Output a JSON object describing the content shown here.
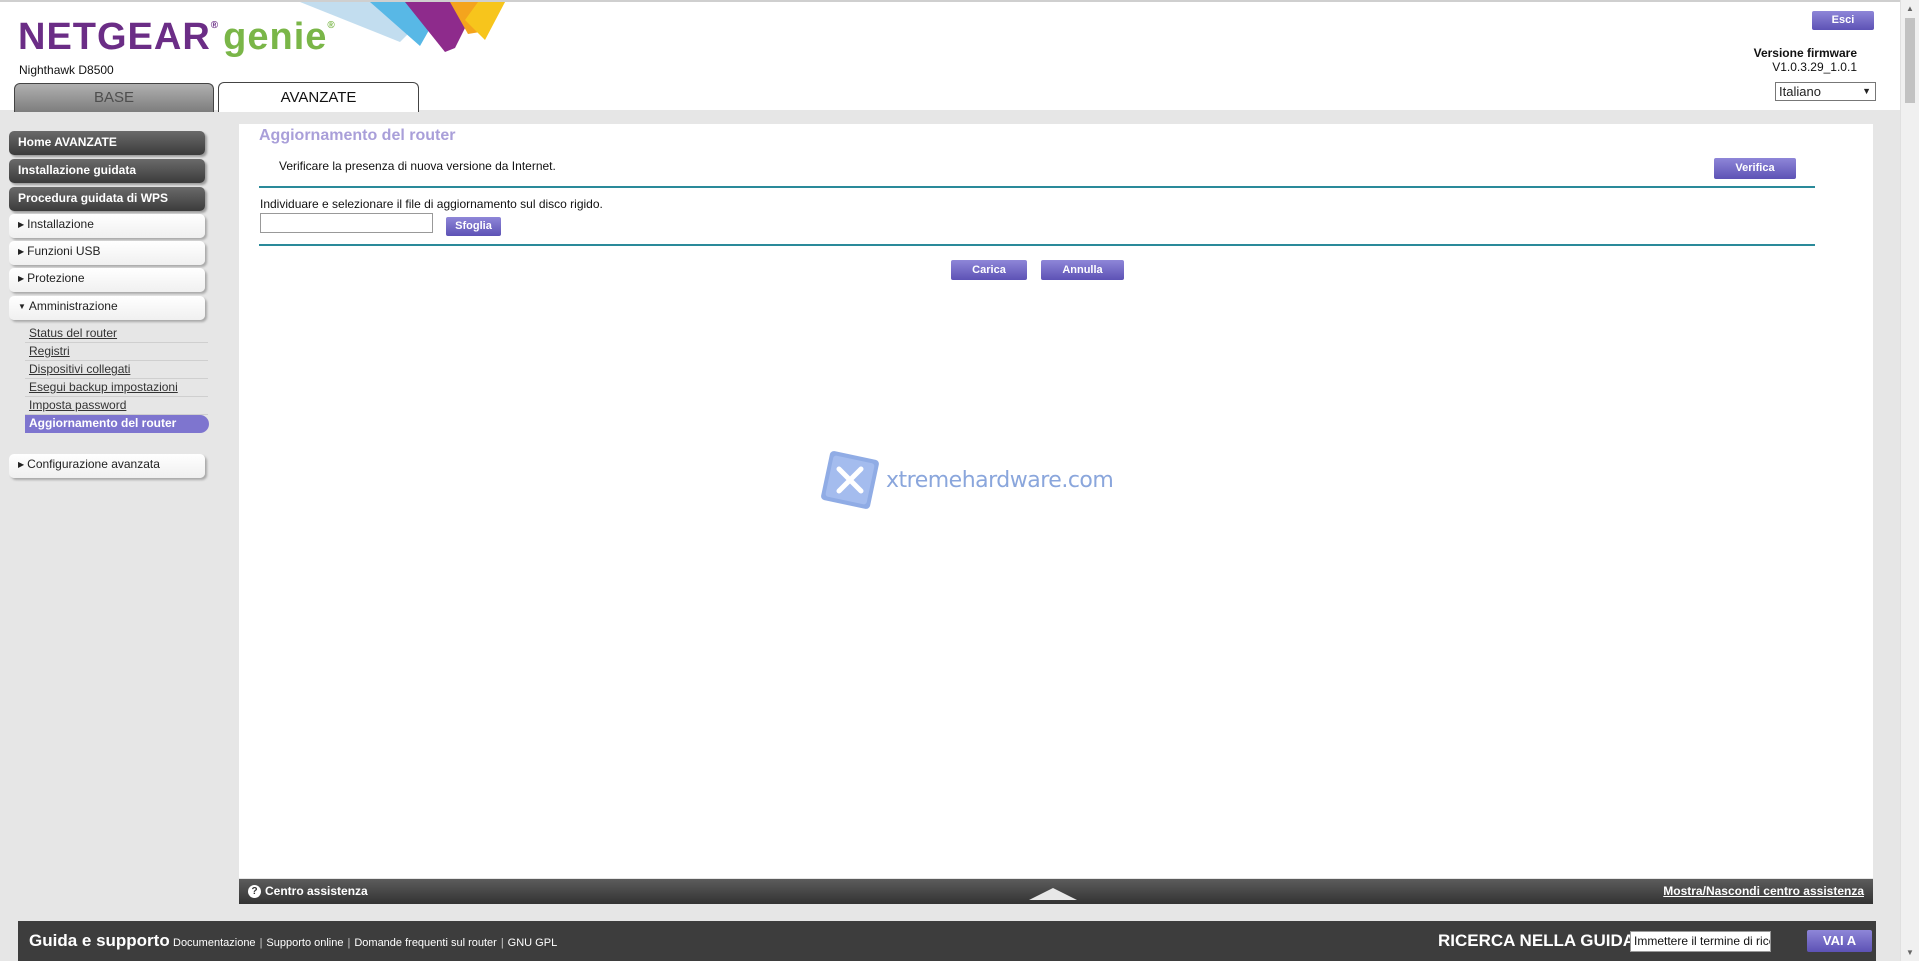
{
  "header": {
    "logo_brand": "NETGEAR",
    "logo_product": "genie",
    "model": "Nighthawk D8500",
    "tabs": [
      {
        "label": "BASE"
      },
      {
        "label": "AVANZATE"
      }
    ],
    "logout_label": "Esci",
    "firmware_label": "Versione firmware",
    "firmware_version": "V1.0.3.29_1.0.1",
    "language": "Italiano",
    "colors": {
      "brand_purple": "#6b2d86",
      "brand_green": "#7ab648",
      "button_purple": "#6f66c6"
    }
  },
  "sidebar": {
    "primary": [
      {
        "label": "Home AVANZATE"
      },
      {
        "label": "Installazione guidata"
      },
      {
        "label": "Procedura guidata di WPS"
      }
    ],
    "sections": [
      {
        "label": "Installazione"
      },
      {
        "label": "Funzioni USB"
      },
      {
        "label": "Protezione"
      },
      {
        "label": "Amministrazione"
      }
    ],
    "admin_items": [
      {
        "label": "Status del router"
      },
      {
        "label": "Registri"
      },
      {
        "label": "Dispositivi collegati"
      },
      {
        "label": "Esegui backup impostazioni"
      },
      {
        "label": "Imposta password"
      },
      {
        "label": "Aggiornamento del router"
      }
    ],
    "advanced": {
      "label": "Configurazione avanzata"
    }
  },
  "main": {
    "title": "Aggiornamento del router",
    "check_text": "Verificare la presenza di nuova versione da Internet.",
    "verify_label": "Verifica",
    "select_text": "Individuare e selezionare il file di aggiornamento sul disco rigido.",
    "browse_label": "Sfoglia",
    "upload_label": "Carica",
    "cancel_label": "Annulla",
    "watermark": "xtremehardware.com"
  },
  "help_bar": {
    "label": "Centro assistenza",
    "toggle_label": "Mostra/Nascondi centro assistenza"
  },
  "footer": {
    "title": "Guida e supporto",
    "links": [
      {
        "label": "Documentazione"
      },
      {
        "label": "Supporto online"
      },
      {
        "label": "Domande frequenti sul router"
      },
      {
        "label": "GNU GPL"
      }
    ],
    "search_label": "RICERCA NELLA GUIDA",
    "search_placeholder": "Immettere il termine di ricerca",
    "go_label": "VAI A"
  }
}
